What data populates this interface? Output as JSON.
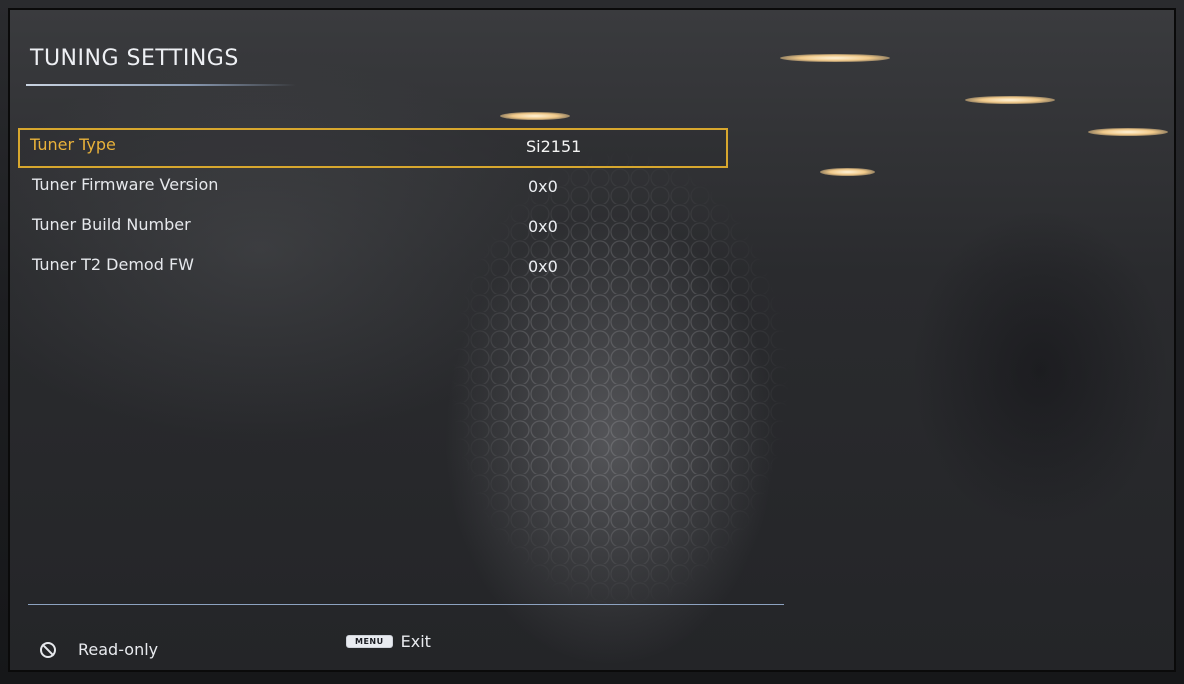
{
  "screen": {
    "title": "TUNING SETTINGS"
  },
  "settings": [
    {
      "label": "Tuner Type",
      "value": "Si2151",
      "selected": true
    },
    {
      "label": "Tuner Firmware Version",
      "value": "0x0",
      "selected": false
    },
    {
      "label": "Tuner Build Number",
      "value": "0x0",
      "selected": false
    },
    {
      "label": "Tuner T2 Demod FW",
      "value": "0x0",
      "selected": false
    }
  ],
  "footer": {
    "readonly_icon": "no-entry-icon",
    "readonly_label": "Read-only",
    "menu_key_label": "MENU",
    "exit_label": "Exit"
  },
  "colors": {
    "selection_border": "#d7a72e",
    "selected_label": "#e9b23a",
    "divider": "#8da2c0"
  }
}
